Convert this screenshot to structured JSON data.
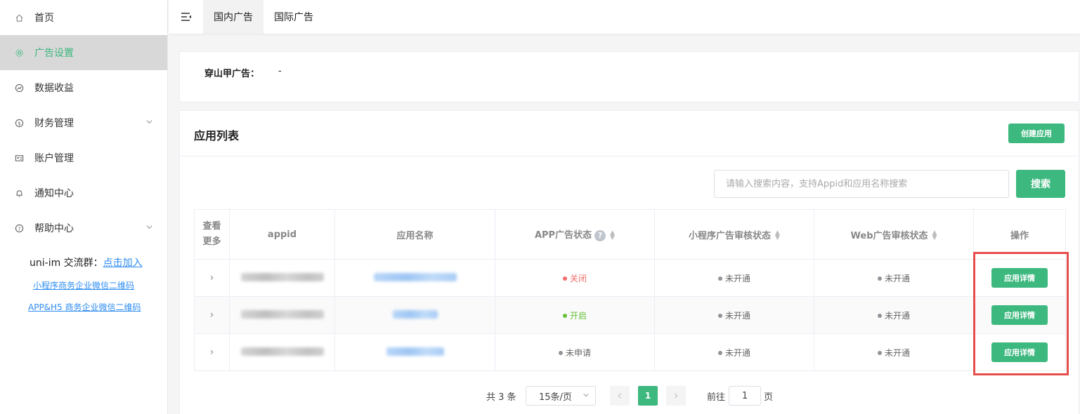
{
  "sidebar": {
    "items": [
      {
        "label": "首页",
        "icon": "home-icon"
      },
      {
        "label": "广告设置",
        "icon": "gear-icon",
        "active": true
      },
      {
        "label": "数据收益",
        "icon": "chart-icon"
      },
      {
        "label": "财务管理",
        "icon": "dollar-icon",
        "expandable": true
      },
      {
        "label": "账户管理",
        "icon": "account-icon"
      },
      {
        "label": "通知中心",
        "icon": "bell-icon"
      },
      {
        "label": "帮助中心",
        "icon": "question-icon",
        "expandable": true
      }
    ],
    "group_prefix": "uni-im 交流群：",
    "group_link": "点击加入",
    "link_miniprogram": "小程序商务企业微信二维码",
    "link_app_h5": "APP&H5 商务企业微信二维码"
  },
  "topbar": {
    "tabs": [
      {
        "label": "国内广告",
        "active": true
      },
      {
        "label": "国际广告",
        "active": false
      }
    ]
  },
  "pangolin": {
    "label": "穿山甲广告：",
    "value": "-"
  },
  "app_list": {
    "title": "应用列表",
    "create_button": "创建应用",
    "search_placeholder": "请输入搜索内容，支持Appid和应用名称搜索",
    "search_button": "搜索",
    "columns": {
      "expand": "查看更多",
      "appid": "appid",
      "name": "应用名称",
      "app_ad_status": "APP广告状态",
      "miniprogram_status": "小程序广告审核状态",
      "web_status": "Web广告审核状态",
      "actions": "操作"
    },
    "rows": [
      {
        "app_ad_status": "关闭",
        "app_ad_status_type": "red",
        "miniprogram_status": "未开通",
        "web_status": "未开通",
        "action": "应用详情"
      },
      {
        "app_ad_status": "开启",
        "app_ad_status_type": "green",
        "miniprogram_status": "未开通",
        "web_status": "未开通",
        "action": "应用详情"
      },
      {
        "app_ad_status": "未申请",
        "app_ad_status_type": "gray",
        "miniprogram_status": "未开通",
        "web_status": "未开通",
        "action": "应用详情"
      }
    ]
  },
  "pagination": {
    "total": "共 3 条",
    "page_size": "15条/页",
    "current_page": "1",
    "goto_prefix": "前往",
    "goto_value": "1",
    "goto_suffix": "页"
  },
  "colors": {
    "accent": "#3db87e",
    "highlight_border": "#e84c4c",
    "status_red": "#f56c6c",
    "status_green": "#67c23a",
    "link_blue": "#2d8cf0"
  }
}
